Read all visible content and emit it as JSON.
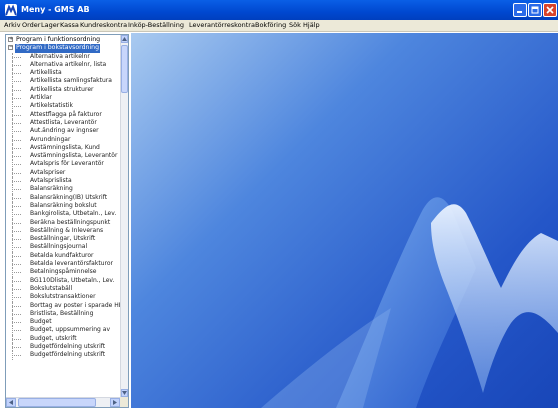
{
  "window": {
    "title": "Meny - GMS AB"
  },
  "menu": [
    "Arkiv",
    "Order",
    "Lager",
    "Kassa",
    "Kundreskontra",
    "Inköp-Beställning",
    "Leverantörreskontra",
    "Bokföring",
    "Sök",
    "Hjälp"
  ],
  "tree": {
    "roots": [
      {
        "label": "Program i funktionsordning",
        "expander": "+",
        "selected": false
      },
      {
        "label": "Program i bokstavsordning",
        "expander": "−",
        "selected": true
      }
    ],
    "items": [
      "Alternativa artikelnr",
      "Alternativa artikelnr, lista",
      "Artikellista",
      "Artikellista samlingsfaktura",
      "Artikellista strukturer",
      "Artiklar",
      "Artikelstatistik",
      "Attestflagga på fakturor",
      "Attestlista, Leverantör",
      "Aut.ändring av ingnser",
      "Avrundningar",
      "Avstämningslista, Kund",
      "Avstämningslista, Leverantör",
      "Avtalspris för Leverantör",
      "Avtalspriser",
      "Avtalsprislista",
      "Balansräkning",
      "Balansräkning(IB) Utskrift",
      "Balansräkning bokslut",
      "Bankgirolista, Utbetaln., Lev.",
      "Beräkna beställningspunkt",
      "Beställning & Inleverans",
      "Beställningar, Utskrift",
      "Beställningsjournal",
      "Betalda kundfakturor",
      "Betalda leverantörsfakturor",
      "Betalningspåminnelse",
      "BG110Dlista, Utbetaln., Lev.",
      "Bokslutstabäll",
      "Bokslutstransaktioner",
      "Borttag av poster i sparade HB",
      "Bristlista, Beställning",
      "Budget",
      "Budget, uppsummering av",
      "Budget, utskrift",
      "Budgetfördelning utskrift",
      "Budgetfördelning utskrift"
    ]
  },
  "icons": {
    "app": "gms-logo-icon",
    "minimize": "minimize-icon",
    "maximize": "maximize-icon",
    "close": "close-icon"
  },
  "colors": {
    "titlebar": "#0a5fe6",
    "selection": "#316ac5",
    "menubar": "#ece9d8",
    "close": "#d8432b",
    "background": "#2456c8"
  }
}
